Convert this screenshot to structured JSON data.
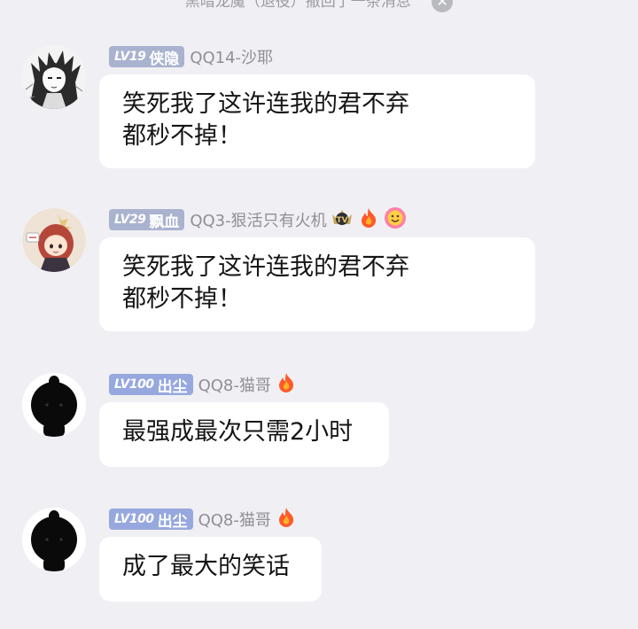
{
  "system_notice": {
    "text": "黑暗龙魔（退役）撤回了一条消息",
    "close_glyph": "✕"
  },
  "messages": [
    {
      "level": "LV19",
      "title": "侠隐",
      "nickname": "QQ14-沙耶",
      "lines": [
        "笑死我了这许连我的君不弃",
        "都秒不掉！"
      ],
      "icons": []
    },
    {
      "level": "LV29",
      "title": "飘血",
      "nickname": "QQ3-狠活只有火机",
      "lines": [
        "笑死我了这许连我的君不弃",
        "都秒不掉！"
      ],
      "icons": [
        "tv-crown-icon",
        "flame-icon",
        "smile-flower-icon"
      ]
    },
    {
      "level": "LV100",
      "title": "出尘",
      "nickname": "QQ8-猫哥",
      "lines": [
        "最强成最次只需2小时"
      ],
      "icons": [
        "flame-icon"
      ]
    },
    {
      "level": "LV100",
      "title": "出尘",
      "nickname": "QQ8-猫哥",
      "lines": [
        "成了最大的笑话"
      ],
      "icons": [
        "flame-icon"
      ]
    }
  ],
  "colors": {
    "background": "#f0f0f4",
    "bubble": "#ffffff",
    "badge_gray": "#a9b2cf",
    "badge_blue": "#97a8de",
    "nickname": "#8e8e96",
    "flame": "#ff6a2a"
  }
}
